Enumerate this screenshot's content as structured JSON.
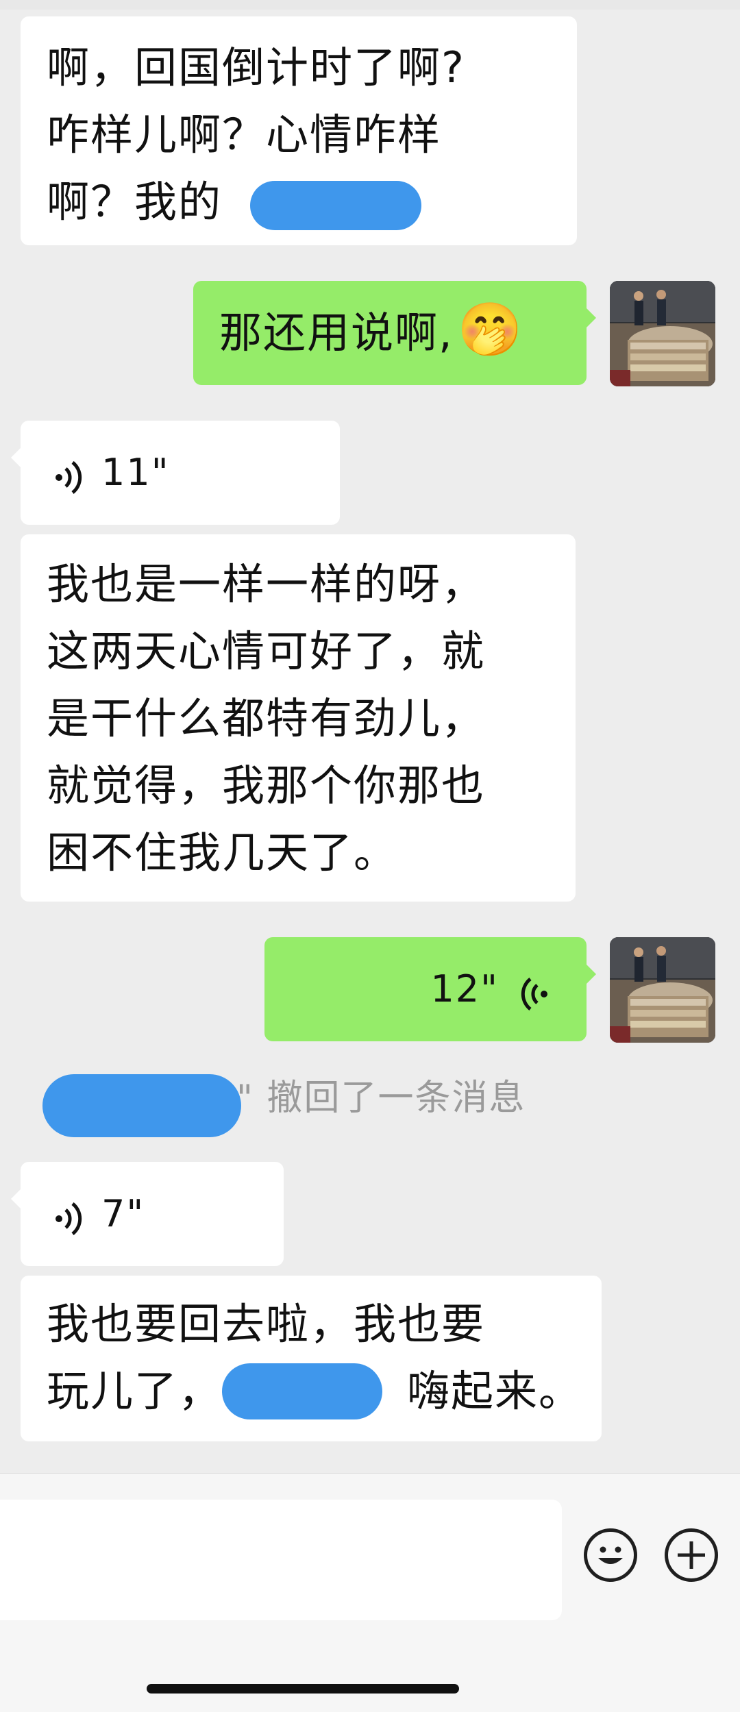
{
  "messages": {
    "m1": {
      "lines": [
        "啊，回国倒计时了啊?",
        "咋样儿啊？心情咋样",
        "啊？我的"
      ]
    },
    "m2": {
      "text": "那还用说啊,",
      "emoji": "🤭"
    },
    "m3": {
      "duration": "11\""
    },
    "m4": {
      "lines": [
        "我也是一样一样的呀，",
        "这两天心情可好了，就",
        "是干什么都特有劲儿，",
        "就觉得，我那个你那也",
        "困不住我几天了。"
      ]
    },
    "m5": {
      "duration": "12\""
    },
    "recall": {
      "text": "\" 撤回了一条消息"
    },
    "m6": {
      "duration": "7\""
    },
    "m7": {
      "line1": "我也要回去啦，我也要",
      "line2_part1": "玩儿了，",
      "line2_part2": "嗨起来。"
    }
  },
  "colors": {
    "background": "#ededed",
    "sent_bubble": "#95ec69",
    "received_bubble": "#ffffff",
    "redaction": "#3f97ec"
  },
  "icons": {
    "voice_received": "voice-wave-right-icon",
    "voice_sent": "voice-wave-left-icon",
    "emoji_button": "smiley-face-icon",
    "plus_button": "plus-circle-icon"
  }
}
